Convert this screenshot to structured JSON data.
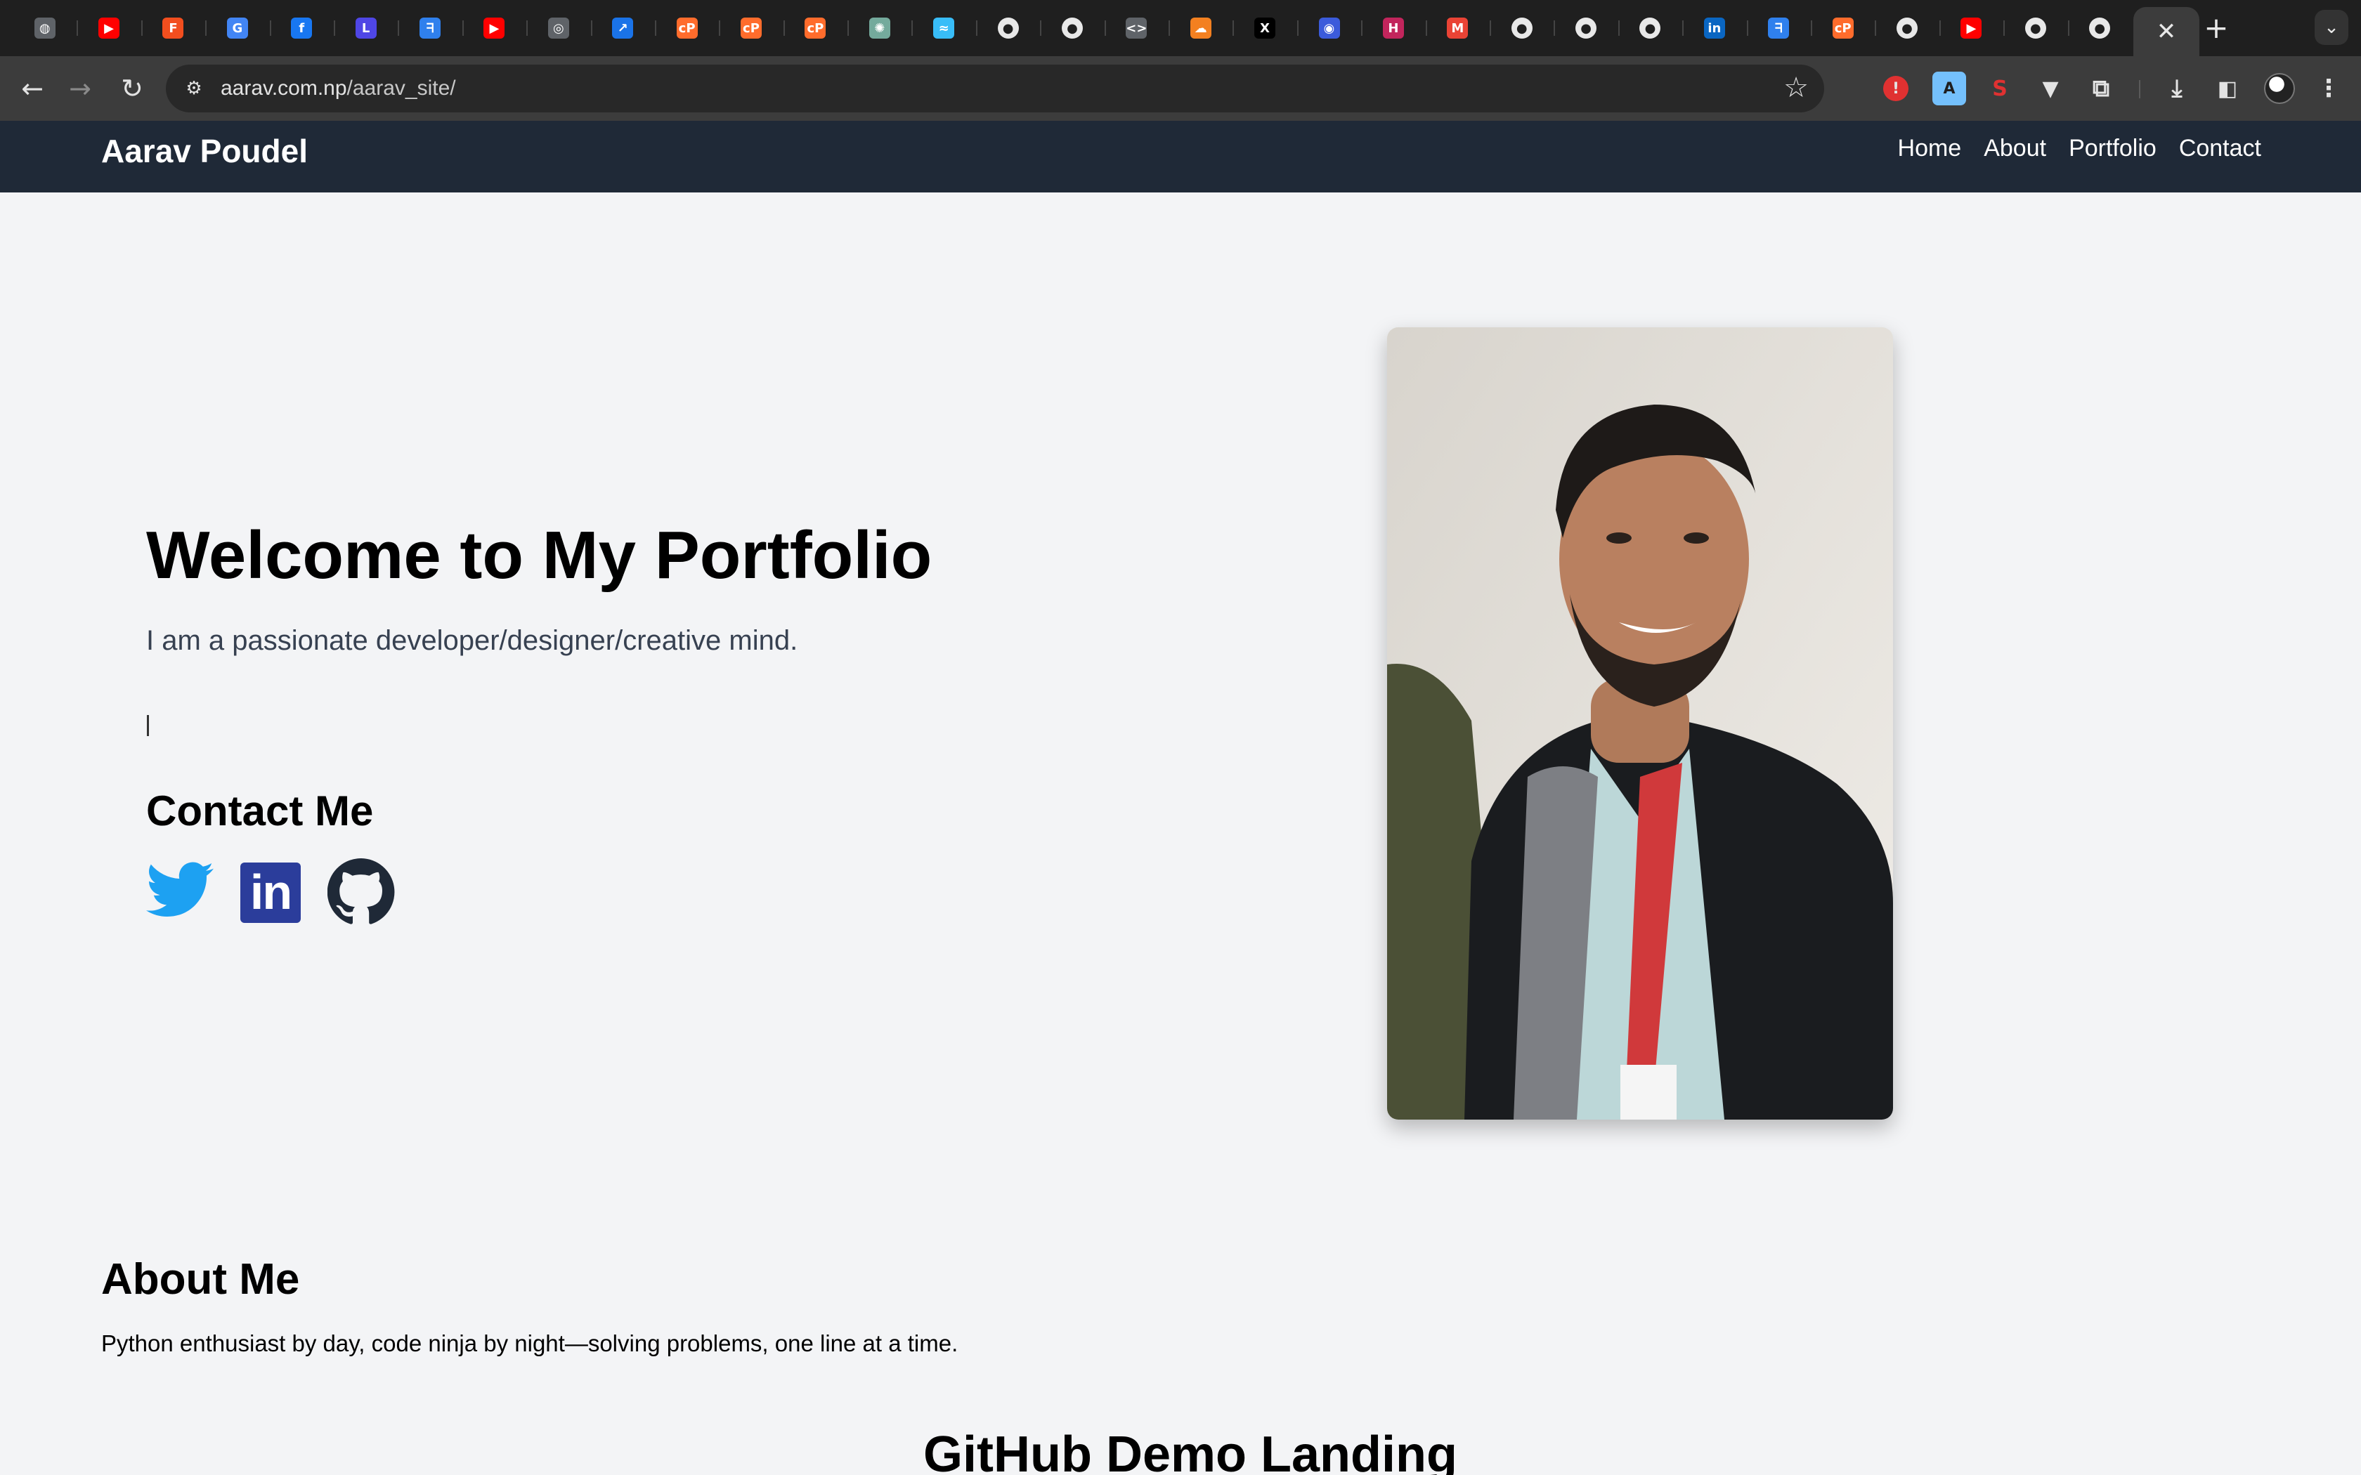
{
  "browser": {
    "tabs": [
      {
        "icon": "globe-icon",
        "glyph": "◍",
        "bg": "#5f6368"
      },
      {
        "icon": "youtube-icon",
        "glyph": "▶",
        "bg": "#ff0000"
      },
      {
        "icon": "figma-icon",
        "glyph": "F",
        "bg": "#f24e1e"
      },
      {
        "icon": "google-icon",
        "glyph": "G",
        "bg": "#4285f4"
      },
      {
        "icon": "facebook-icon",
        "glyph": "f",
        "bg": "#1877f2"
      },
      {
        "icon": "site-icon",
        "glyph": "L",
        "bg": "#4f46e5"
      },
      {
        "icon": "app-icon",
        "glyph": "ᖷ",
        "bg": "#2f80ed"
      },
      {
        "icon": "youtube-icon",
        "glyph": "▶",
        "bg": "#ff0000"
      },
      {
        "icon": "chrome-icon",
        "glyph": "◎",
        "bg": "#5f6368"
      },
      {
        "icon": "chart-app-icon",
        "glyph": "↗",
        "bg": "#1a73e8"
      },
      {
        "icon": "cpanel-icon",
        "glyph": "cP",
        "bg": "#ff6c2c"
      },
      {
        "icon": "cpanel-icon",
        "glyph": "cP",
        "bg": "#ff6c2c"
      },
      {
        "icon": "cpanel-icon",
        "glyph": "cP",
        "bg": "#ff6c2c"
      },
      {
        "icon": "chatgpt-icon",
        "glyph": "✺",
        "bg": "#74aa9c"
      },
      {
        "icon": "tailwind-icon",
        "glyph": "≈",
        "bg": "#38bdf8"
      },
      {
        "icon": "github-icon",
        "glyph": "●",
        "bg": "gh"
      },
      {
        "icon": "github-icon",
        "glyph": "●",
        "bg": "gh"
      },
      {
        "icon": "code-icon",
        "glyph": "<>",
        "bg": "#5f6368"
      },
      {
        "icon": "cloudflare-icon",
        "glyph": "☁",
        "bg": "#f38020"
      },
      {
        "icon": "x-icon",
        "glyph": "X",
        "bg": "#000000"
      },
      {
        "icon": "search-app-icon",
        "glyph": "◉",
        "bg": "#3b5bdb"
      },
      {
        "icon": "app-icon",
        "glyph": "H",
        "bg": "#c2255c"
      },
      {
        "icon": "gmail-icon",
        "glyph": "M",
        "bg": "#ea4335"
      },
      {
        "icon": "github-icon",
        "glyph": "●",
        "bg": "gh"
      },
      {
        "icon": "github-icon",
        "glyph": "●",
        "bg": "gh"
      },
      {
        "icon": "github-icon",
        "glyph": "●",
        "bg": "gh"
      },
      {
        "icon": "linkedin-icon",
        "glyph": "in",
        "bg": "#0a66c2"
      },
      {
        "icon": "app-icon",
        "glyph": "ᖷ",
        "bg": "#2f80ed"
      },
      {
        "icon": "cpanel-icon",
        "glyph": "cP",
        "bg": "#ff6c2c"
      },
      {
        "icon": "github-icon",
        "glyph": "●",
        "bg": "gh"
      },
      {
        "icon": "youtube-icon",
        "glyph": "▶",
        "bg": "#ff0000"
      },
      {
        "icon": "github-icon",
        "glyph": "●",
        "bg": "gh"
      },
      {
        "icon": "github-icon",
        "glyph": "●",
        "bg": "gh"
      }
    ],
    "url_host": "aarav.com.np",
    "url_path": "/aarav_site/"
  },
  "site": {
    "brand": "Aarav Poudel",
    "nav": [
      "Home",
      "About",
      "Portfolio",
      "Contact"
    ],
    "hero_title": "Welcome to My Portfolio",
    "hero_subtitle": "I am a passionate developer/designer/creative mind.",
    "contact_title": "Contact Me",
    "social": [
      "twitter-icon",
      "linkedin-icon",
      "github-icon"
    ],
    "about_title": "About Me",
    "about_text": "Python enthusiast by day, code ninja by night—solving problems, one line at a time.",
    "github_demo_title": "GitHub Demo Landing"
  },
  "colors": {
    "nav_bg": "#1f2937",
    "page_bg": "#f3f4f6",
    "twitter": "#1da1f2",
    "linkedin": "#2b3d9b",
    "github": "#1f2937"
  }
}
